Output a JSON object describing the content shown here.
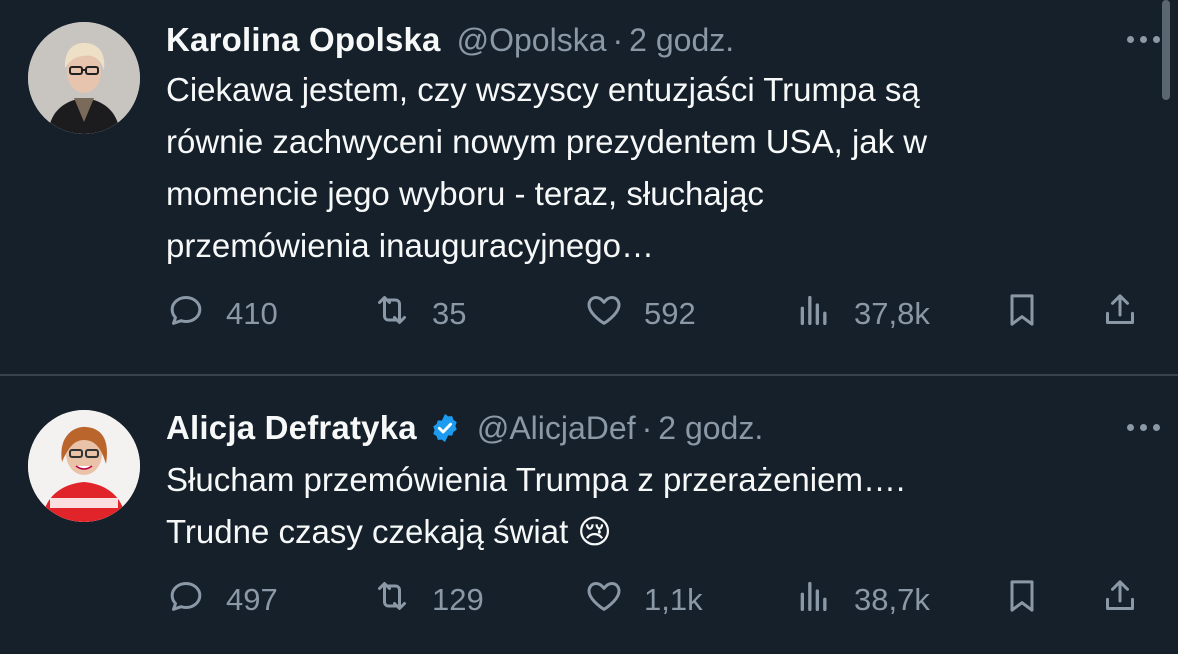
{
  "tweets": [
    {
      "name": "Karolina Opolska",
      "handle": "@Opolska",
      "separator": "·",
      "time": "2 godz.",
      "verified": false,
      "text": "Ciekawa jestem, czy wszyscy entuzjaści Trumpa są\nrównie zachwyceni nowym prezydentem USA, jak w\nmomencie jego wyboru - teraz, słuchając\nprzemówienia inauguracyjnego…",
      "replies": "410",
      "reposts": "35",
      "likes": "592",
      "views": "37,8k"
    },
    {
      "name": "Alicja Defratyka",
      "handle": "@AlicjaDef",
      "separator": "·",
      "time": "2 godz.",
      "verified": true,
      "text": "Słucham przemówienia Trumpa z przerażeniem….\nTrudne czasy czekają świat 😢",
      "replies": "497",
      "reposts": "129",
      "likes": "1,1k",
      "views": "38,7k"
    }
  ],
  "colors": {
    "background": "#15202b",
    "text": "#f7f9f9",
    "muted": "#8b98a5",
    "divider": "#38444d",
    "verified": "#1d9bf0"
  }
}
